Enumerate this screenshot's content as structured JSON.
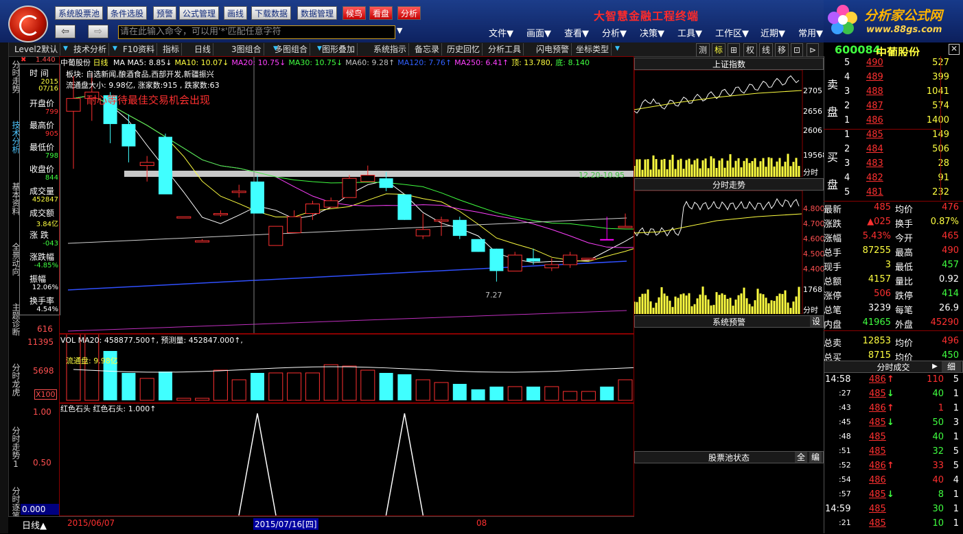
{
  "toolbar": {
    "buttons": [
      "系统股票池",
      "条件选股",
      "预警",
      "公式管理",
      "画线",
      "下载数据",
      "数据管理"
    ],
    "red_buttons": [
      "候鸟",
      "看盘",
      "分析"
    ],
    "app_title": "大智慧金融工程终端",
    "command_placeholder": "请在此输入命令，可以用'*'匹配任意字符",
    "menus": [
      "文件▼",
      "画面▼",
      "查看▼",
      "分析▼",
      "决策▼",
      "工具▼",
      "工作区▼",
      "近期▼",
      "常用▼"
    ],
    "brand_name": "分析家公式网",
    "brand_url": "www.88gs.com"
  },
  "secbar": {
    "items": [
      "Level2默认",
      "技术分析",
      "F10资料",
      "指标",
      "日线",
      "3图组合",
      "多图组合",
      "图形叠加",
      "系统指示",
      "备忘录",
      "历史回忆",
      "分析工具",
      "闪电预警",
      "坐标类型"
    ],
    "right_items": [
      "测",
      "标",
      "⊞",
      "权",
      "线",
      "移",
      "⊡",
      "⊳"
    ]
  },
  "left_tabs": [
    "分时走势",
    "技术分析",
    "基本资料",
    "全景动向",
    "主题诊断",
    "分时龙虎",
    "分时走势1",
    "分时逐笔"
  ],
  "info_panel": {
    "rows": [
      {
        "label": "时  间",
        "value": "2015"
      },
      {
        "label": "",
        "value": "07/16"
      },
      {
        "label": "开盘价",
        "value": "799"
      },
      {
        "label": "最高价",
        "value": "905"
      },
      {
        "label": "最低价",
        "value": "798"
      },
      {
        "label": "收盘价",
        "value": "844"
      },
      {
        "label": "成交量",
        "value": "452847"
      },
      {
        "label": "成交额",
        "value": "3.84亿"
      },
      {
        "label": "涨  跌",
        "value": "-043"
      },
      {
        "label": "涨跌幅",
        "value": "-4.85%"
      },
      {
        "label": "振幅",
        "value": "12.06%"
      },
      {
        "label": "换手率",
        "value": "4.54%"
      }
    ]
  },
  "main_chart": {
    "stock_name": "中葡股份",
    "period": "日线",
    "ma_legend": [
      {
        "text": "MA MA5: 8.85↓",
        "color": "#ffffff"
      },
      {
        "text": "MA10: 10.07↓",
        "color": "#ffff40"
      },
      {
        "text": "MA20: 10.75↓",
        "color": "#ff40ff"
      },
      {
        "text": "MA30: 10.75↓",
        "color": "#40ff40"
      },
      {
        "text": "MA60: 9.28↑",
        "color": "#c0c0c0"
      },
      {
        "text": "MA120: 7.76↑",
        "color": "#3060ff"
      },
      {
        "text": "MA250: 6.41↑",
        "color": "#ff40ff"
      },
      {
        "text": "顶: 13.780,",
        "color": "#ffff40"
      },
      {
        "text": "底: 8.140",
        "color": "#40ff40"
      }
    ],
    "sector": "板块: 自选新闻,酿酒食品,西部开发,新疆振兴",
    "float_info": "流通盘大小: 9.98亿, 涨家数:915 , 跌家数:63",
    "slogan": "耐心等待最佳交易机会出现",
    "price_top": "1.440",
    "price_bottom": "616",
    "range_label": "12.20-10.95",
    "low_label": "7.27",
    "candles": [
      [
        12.6,
        13.7,
        10.8,
        13.0
      ],
      [
        13.0,
        13.8,
        12.3,
        13.2
      ],
      [
        13.1,
        13.2,
        11.6,
        12.2
      ],
      [
        12.2,
        12.5,
        11.0,
        11.5
      ],
      [
        11.0,
        11.2,
        10.4,
        10.9
      ],
      [
        11.8,
        11.9,
        10.0,
        10.0
      ],
      [
        9.3,
        9.3,
        9.25,
        9.3
      ],
      [
        8.55,
        8.6,
        8.5,
        8.55
      ],
      [
        9.4,
        9.5,
        9.3,
        9.4
      ],
      [
        10.1,
        10.3,
        9.9,
        10.1
      ],
      [
        10.4,
        10.6,
        9.4,
        9.4
      ],
      [
        8.4,
        9.0,
        8.4,
        9.0
      ],
      [
        8.8,
        9.5,
        8.8,
        9.3
      ],
      [
        9.4,
        9.8,
        9.2,
        9.7
      ],
      [
        9.6,
        9.9,
        9.6,
        9.8
      ],
      [
        9.9,
        10.6,
        9.9,
        10.5
      ],
      [
        10.4,
        10.9,
        10.4,
        10.6
      ],
      [
        10.5,
        10.7,
        10.1,
        10.2
      ],
      [
        10.0,
        10.0,
        9.2,
        9.2
      ],
      [
        8.7,
        9.4,
        8.6,
        8.9
      ],
      [
        9.2,
        9.3,
        8.7,
        9.2
      ],
      [
        9.2,
        9.3,
        8.6,
        8.7
      ],
      [
        8.6,
        8.6,
        8.2,
        8.2
      ],
      [
        8.3,
        8.3,
        7.27,
        7.6
      ],
      [
        7.6,
        8.2,
        7.6,
        8.1
      ],
      [
        8.0,
        8.3,
        7.8,
        7.9
      ],
      [
        7.8,
        8.0,
        7.6,
        7.7
      ],
      [
        7.8,
        8.2,
        7.7,
        8.1
      ],
      [
        8.0,
        8.0,
        8.0,
        8.0
      ],
      [
        8.6,
        9.3,
        8.6,
        8.6
      ],
      [
        9.0,
        9.4,
        9.0,
        9.0
      ],
      [
        8.9,
        9.1,
        8.9,
        9.0
      ],
      [
        9.0,
        9.1,
        8.8,
        9.1
      ]
    ],
    "candle_kinds": [
      "up",
      "up",
      "down",
      "down",
      "up",
      "down",
      "up",
      "up",
      "up",
      "up",
      "down",
      "up",
      "up",
      "up",
      "up",
      "up",
      "up",
      "down",
      "down",
      "up",
      "up",
      "down",
      "down",
      "down",
      "up",
      "down",
      "up",
      "up",
      "up",
      "pink",
      "up",
      "up",
      "up"
    ]
  },
  "vol_chart": {
    "legend": "VOL MA20: 458877.500↑, 预测量: 452847.000↑,",
    "float_label": "流通盘: 9.98亿",
    "ticks": [
      "11395",
      "5698",
      "X100"
    ],
    "vols": [
      98,
      98,
      72,
      40,
      32,
      42,
      3,
      3,
      44,
      30,
      40,
      40,
      40,
      40,
      52,
      50,
      44,
      40,
      38,
      30,
      26,
      24,
      16,
      20,
      20,
      20,
      20,
      13,
      13,
      20,
      30,
      26,
      20
    ]
  },
  "ind_chart": {
    "legend": "红色石头  红色石头: 1.000↑",
    "ticks": [
      "1.00",
      "0.50",
      "0.000"
    ],
    "signal_indices": [
      10,
      18
    ]
  },
  "bottom": {
    "period_label": "日线▲",
    "date_left": "2015/06/07",
    "date_cursor": "2015/07/16[四]",
    "date_right": "08"
  },
  "right_panels": {
    "sh_title": "上证指数",
    "sh_ticks": [
      "2705",
      "2656",
      "2606",
      "19568",
      "分时"
    ],
    "fs_title": "分时走势",
    "fs_ticks": [
      "4.800",
      "4.700",
      "4.600",
      "4.500",
      "4.400",
      "1768",
      "分时"
    ],
    "alert_title": "系统预警",
    "alert_btn": "设",
    "pool_title": "股票池状态",
    "pool_btns": [
      "全",
      "编"
    ]
  },
  "quote": {
    "code": "600084",
    "name": "中葡股份",
    "sell_label": "卖盘",
    "buy_label": "买盘",
    "sell": [
      {
        "n": "5",
        "p": "490",
        "v": "527"
      },
      {
        "n": "4",
        "p": "489",
        "v": "399"
      },
      {
        "n": "3",
        "p": "488",
        "v": "1041"
      },
      {
        "n": "2",
        "p": "487",
        "v": "574"
      },
      {
        "n": "1",
        "p": "486",
        "v": "1400"
      }
    ],
    "buy": [
      {
        "n": "1",
        "p": "485",
        "v": "149"
      },
      {
        "n": "2",
        "p": "484",
        "v": "506"
      },
      {
        "n": "3",
        "p": "483",
        "v": "28"
      },
      {
        "n": "4",
        "p": "482",
        "v": "91"
      },
      {
        "n": "5",
        "p": "481",
        "v": "232"
      }
    ],
    "stats": [
      {
        "l1": "最新",
        "v1": "485",
        "c1": "#ff3030",
        "l2": "均价",
        "v2": "476",
        "c2": "#ff3030"
      },
      {
        "l1": "涨跌",
        "v1": "▲025",
        "c1": "#ff3030",
        "l2": "换手",
        "v2": "0.87%",
        "c2": "#ffff40"
      },
      {
        "l1": "涨幅",
        "v1": "5.43%",
        "c1": "#ff3030",
        "l2": "今开",
        "v2": "465",
        "c2": "#ff3030"
      },
      {
        "l1": "总手",
        "v1": "87255",
        "c1": "#ffff40",
        "l2": "最高",
        "v2": "490",
        "c2": "#ff3030"
      },
      {
        "l1": "现手",
        "v1": "3",
        "c1": "#ffff40",
        "l2": "最低",
        "v2": "457",
        "c2": "#40ff40"
      },
      {
        "l1": "总额",
        "v1": "4157",
        "c1": "#ffff40",
        "l2": "量比",
        "v2": "0.92",
        "c2": "#ffffff"
      },
      {
        "l1": "涨停",
        "v1": "506",
        "c1": "#ff3030",
        "l2": "跌停",
        "v2": "414",
        "c2": "#40ff40"
      },
      {
        "l1": "总笔",
        "v1": "3239",
        "c1": "#ffffff",
        "l2": "每笔",
        "v2": "26.9",
        "c2": "#ffffff"
      },
      {
        "l1": "内盘",
        "v1": "41965",
        "c1": "#40ff40",
        "l2": "外盘",
        "v2": "45290",
        "c2": "#ff3030"
      },
      {
        "l1": "总卖",
        "v1": "12853",
        "c1": "#ffff40",
        "l2": "均价",
        "v2": "496",
        "c2": "#ff3030"
      },
      {
        "l1": "总买",
        "v1": "8715",
        "c1": "#ffff40",
        "l2": "均价",
        "v2": "450",
        "c2": "#40ff40"
      }
    ],
    "ticks_title": "分时成交",
    "ticks_btn": "细",
    "ticks": [
      {
        "t": "14:58",
        "p": "486",
        "a": "↑",
        "ac": "#ff3030",
        "v": "110",
        "n": "5"
      },
      {
        "t": ":27",
        "p": "485",
        "a": "↓",
        "ac": "#40ff40",
        "v": "40",
        "n": "1"
      },
      {
        "t": ":43",
        "p": "486",
        "a": "↑",
        "ac": "#ff3030",
        "v": "1",
        "n": "1"
      },
      {
        "t": ":45",
        "p": "485",
        "a": "↓",
        "ac": "#40ff40",
        "v": "50",
        "n": "3"
      },
      {
        "t": ":48",
        "p": "485",
        "a": "",
        "ac": "#40ff40",
        "v": "40",
        "n": "1"
      },
      {
        "t": ":51",
        "p": "485",
        "a": "",
        "ac": "#40ff40",
        "v": "32",
        "n": "5"
      },
      {
        "t": ":52",
        "p": "486",
        "a": "↑",
        "ac": "#ff3030",
        "v": "33",
        "n": "5"
      },
      {
        "t": ":54",
        "p": "486",
        "a": "",
        "ac": "#ff3030",
        "v": "40",
        "n": "4"
      },
      {
        "t": ":57",
        "p": "485",
        "a": "↓",
        "ac": "#40ff40",
        "v": "8",
        "n": "1"
      },
      {
        "t": "14:59",
        "p": "485",
        "a": "",
        "ac": "#40ff40",
        "v": "30",
        "n": "1"
      },
      {
        "t": ":21",
        "p": "485",
        "a": "",
        "ac": "#40ff40",
        "v": "10",
        "n": "1"
      }
    ]
  }
}
